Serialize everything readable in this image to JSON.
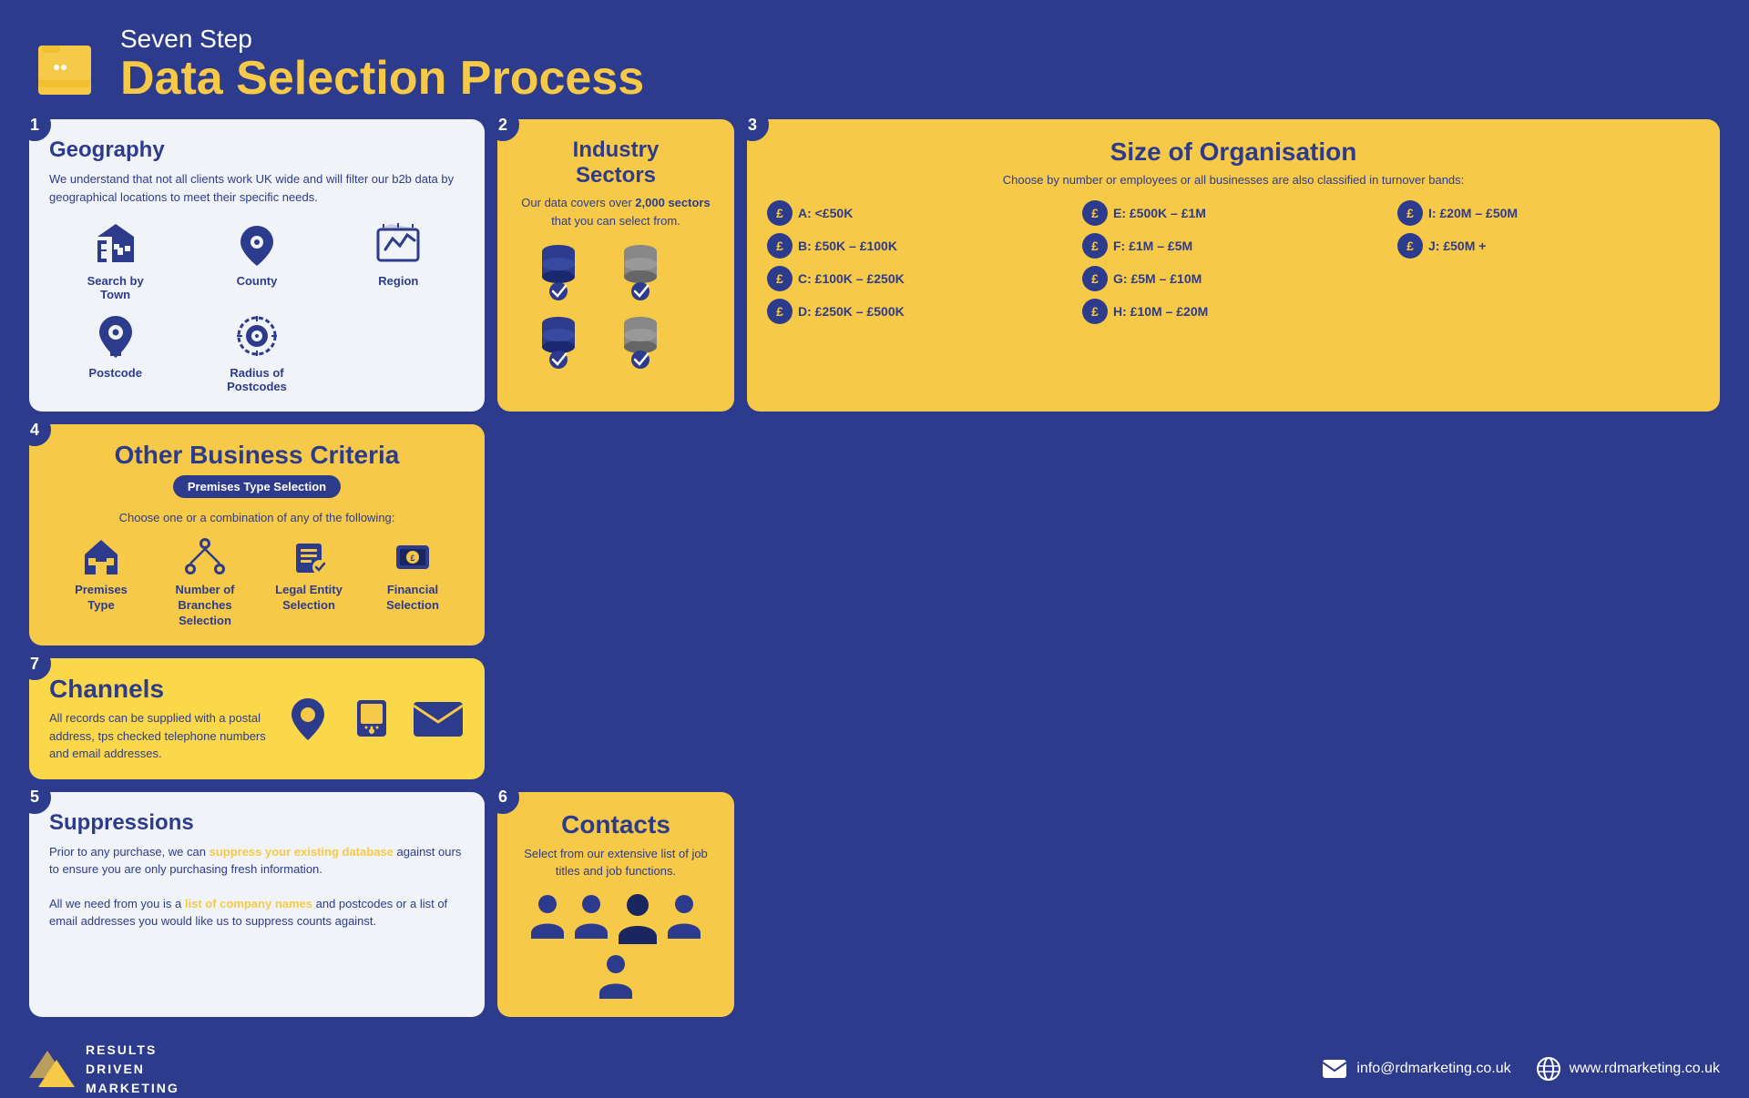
{
  "header": {
    "subtitle": "Seven Step",
    "title": "Data Selection Process"
  },
  "steps": {
    "geography": {
      "step": "1",
      "title": "Geography",
      "description": "We understand that not all clients work UK wide and will filter our b2b data by geographical locations to meet their specific needs.",
      "options": [
        {
          "label": "Search by Town",
          "icon": "building"
        },
        {
          "label": "County",
          "icon": "location"
        },
        {
          "label": "Region",
          "icon": "map"
        },
        {
          "label": "Postcode",
          "icon": "postcode"
        },
        {
          "label": "Radius of Postcodes",
          "icon": "radius"
        }
      ]
    },
    "industry": {
      "step": "2",
      "title": "Industry Sectors",
      "description": "Our data covers over 2,000 sectors that you can select from."
    },
    "size": {
      "step": "3",
      "title": "Size of Organisation",
      "subtitle": "Choose by number or employees or all businesses are also classified in turnover bands:",
      "bands": [
        "A: <£50K",
        "E: £500K – £1M",
        "I: £20M – £50M",
        "B: £50K – £100K",
        "F: £1M – £5M",
        "J: £50M +",
        "C: £100K – £250K",
        "G: £5M – £10M",
        "",
        "D: £250K – £500K",
        "H: £10M – £20M",
        ""
      ]
    },
    "other": {
      "step": "4",
      "title": "Other Business Criteria",
      "badge": "Premises Type Selection",
      "subtitle": "Choose one or a combination of any of the following:",
      "options": [
        {
          "label": "Premises Type",
          "icon": "building2"
        },
        {
          "label": "Number of Branches Selection",
          "icon": "branches"
        },
        {
          "label": "Legal Entity Selection",
          "icon": "entity"
        },
        {
          "label": "Financial Selection",
          "icon": "financial"
        }
      ]
    },
    "suppressions": {
      "step": "5",
      "title": "Suppressions",
      "text1": "Prior to any purchase, we can suppress your existing database against ours to ensure you are only purchasing fresh information.",
      "highlight1": "suppress your existing database",
      "text2_pre": "All we need from you is a ",
      "highlight2": "list of company names",
      "text2_post": " and postcodes or a list of email addresses you would like us to suppress counts against."
    },
    "contacts": {
      "step": "6",
      "title": "Contacts",
      "description": "Select from our extensive list of job titles and job functions."
    },
    "channels": {
      "step": "7",
      "title": "Channels",
      "description": "All records can be supplied with a postal address, tps checked telephone numbers and email addresses."
    }
  },
  "footer": {
    "company": "RESULTS\nDRIVEN\nMARKETING",
    "email": "info@rdmarketing.co.uk",
    "website": "www.rdmarketing.co.uk"
  }
}
